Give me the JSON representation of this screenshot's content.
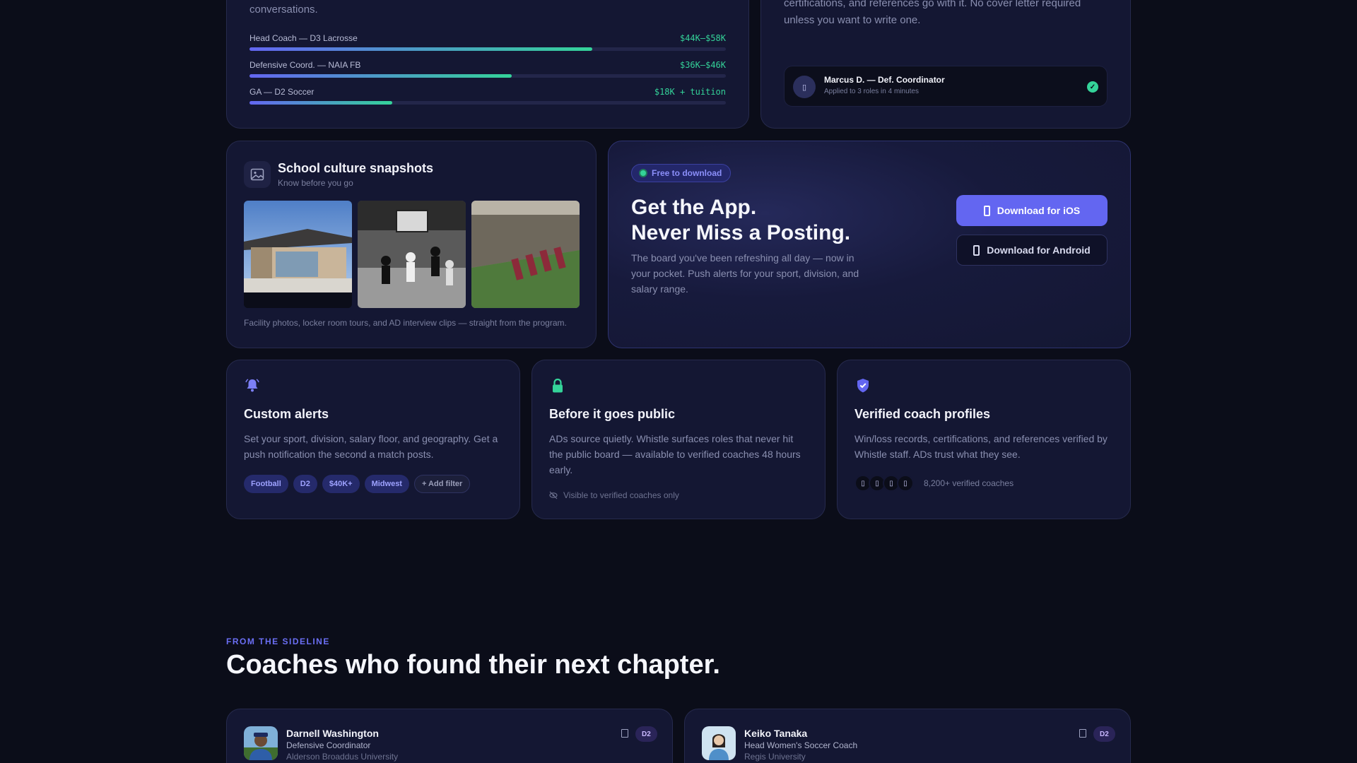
{
  "salary": {
    "intro": "conversations.",
    "rows": [
      {
        "label": "Head Coach — D3 Lacrosse",
        "amount": "$44K–$58K",
        "fill": 0.72
      },
      {
        "label": "Defensive Coord. — NAIA FB",
        "amount": "$36K–$46K",
        "fill": 0.55
      },
      {
        "label": "GA — D2 Soccer",
        "amount": "$18K + tuition",
        "fill": 0.3
      }
    ]
  },
  "apply": {
    "text": "certifications, and references go with it. No cover letter required unless you want to write one.",
    "applicant_name": "Marcus D. — Def. Coordinator",
    "applicant_sub": "Applied to 3 roles in 4 minutes"
  },
  "snapshots": {
    "title": "School culture snapshots",
    "subtitle": "Know before you go",
    "caption": "Facility photos, locker room tours, and AD interview clips — straight from the program."
  },
  "app": {
    "badge": "Free to download",
    "title_line1": "Get the App.",
    "title_line2": "Never Miss a Posting.",
    "description": "The board you've been refreshing all day — now in your pocket. Push alerts for your sport, division, and salary range.",
    "ios_label": "Download for iOS",
    "android_label": "Download for Android"
  },
  "features": {
    "alerts": {
      "title": "Custom alerts",
      "description": "Set your sport, division, salary floor, and geography. Get a push notification the second a match posts.",
      "chips": [
        "Football",
        "D2",
        "$40K+",
        "Midwest"
      ],
      "add_chip": "+ Add filter"
    },
    "early": {
      "title": "Before it goes public",
      "description": "ADs source quietly. Whistle surfaces roles that never hit the public board — available to verified coaches 48 hours early.",
      "note": "Visible to verified coaches only"
    },
    "verified": {
      "title": "Verified coach profiles",
      "description": "Win/loss records, certifications, and references verified by Whistle staff. ADs trust what they see.",
      "count": "8,200+ verified coaches"
    }
  },
  "section": {
    "eyebrow": "FROM THE SIDELINE",
    "title": "Coaches who found their next chapter."
  },
  "testimonials": [
    {
      "name": "Darnell Washington",
      "role": "Defensive Coordinator",
      "school": "Alderson Broaddus University",
      "badge": "D2"
    },
    {
      "name": "Keiko Tanaka",
      "role": "Head Women's Soccer Coach",
      "school": "Regis University",
      "badge": "D2"
    }
  ],
  "colors": {
    "accent": "#6366f1",
    "success": "#34d399",
    "background": "#0b0d19",
    "card": "#141733"
  }
}
